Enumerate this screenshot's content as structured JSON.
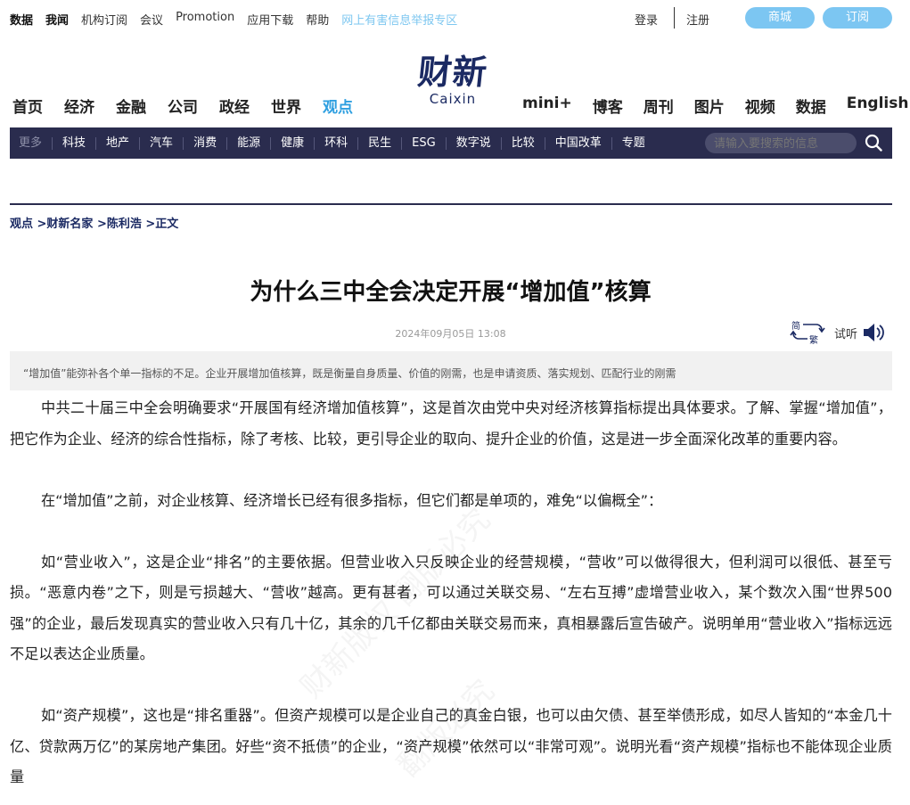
{
  "topbar": {
    "links": [
      "数据",
      "我闻",
      "机构订阅",
      "会议",
      "Promotion",
      "应用下载",
      "帮助"
    ],
    "report_link": "网上有害信息举报专区",
    "login": "登录",
    "register": "注册",
    "mall": "商城",
    "subscribe": "订阅"
  },
  "logo": {
    "mark": "财新",
    "sub": "Caixin"
  },
  "main_nav": {
    "left": [
      "首页",
      "经济",
      "金融",
      "公司",
      "政经",
      "世界",
      "观点"
    ],
    "active": "观点",
    "right": [
      "mini+",
      "博客",
      "周刊",
      "图片",
      "视频",
      "数据",
      "English"
    ]
  },
  "sub_nav": {
    "more": "更多",
    "items": [
      "科技",
      "地产",
      "汽车",
      "消费",
      "能源",
      "健康",
      "环科",
      "民生",
      "ESG",
      "数字说",
      "比较",
      "中国改革",
      "专题"
    ],
    "search_placeholder": "请输入要搜索的信息"
  },
  "breadcrumb": "观点 >财新名家 >陈利浩 >正文",
  "article": {
    "title": "为什么三中全会决定开展“增加值”核算",
    "date": "2024年09月05日 13:08",
    "convert_icon_label": "简繁",
    "listen": "试听",
    "summary": "“增加值”能弥补各个单一指标的不足。企业开展增加值核算，既是衡量自身质量、价值的刚需，也是申请资质、落实规划、匹配行业的刚需",
    "paragraphs": [
      "中共二十届三中全会明确要求“开展国有经济增加值核算”，这是首次由党中央对经济核算指标提出具体要求。了解、掌握“增加值”，把它作为企业、经济的综合性指标，除了考核、比较，更引导企业的取向、提升企业的价值，这是进一步全面深化改革的重要内容。",
      "在“增加值”之前，对企业核算、经济增长已经有很多指标，但它们都是单项的，难免“以偏概全”：",
      "如“营业收入”，这是企业“排名”的主要依据。但营业收入只反映企业的经营规模，“营收”可以做得很大，但利润可以很低、甚至亏损。“恶意内卷”之下，则是亏损越大、“营收”越高。更有甚者，可以通过关联交易、“左右互搏”虚增营业收入，某个数次入围“世界500强”的企业，最后发现真实的营业收入只有几十亿，其余的几千亿都由关联交易而来，真相暴露后宣告破产。说明单用“营业收入”指标远远不足以表达企业质量。",
      "如“资产规模”，这也是“排名重器”。但资产规模可以是企业自己的真金白银，也可以由欠债、甚至举债形成，如尽人皆知的“本金几十亿、贷款两万亿”的某房地产集团。好些“资不抵债”的企业，“资产规模”依然可以“非常可观”。说明光看“资产规模”指标也不能体现企业质量"
    ]
  }
}
